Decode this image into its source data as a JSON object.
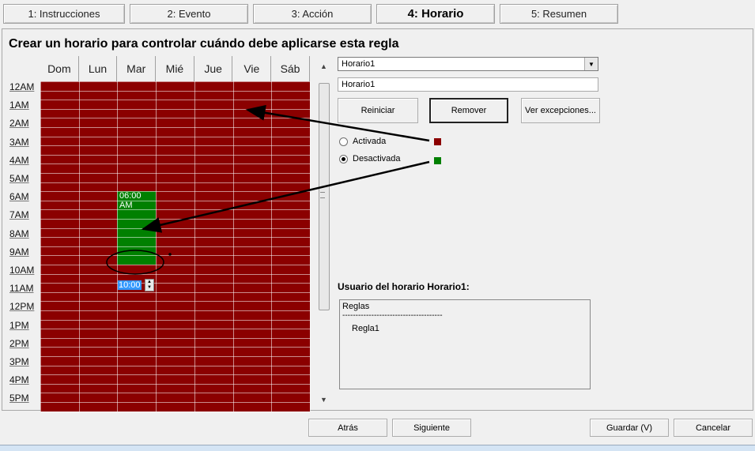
{
  "tabs": [
    {
      "label": "1: Instrucciones"
    },
    {
      "label": "2: Evento"
    },
    {
      "label": "3: Acción"
    },
    {
      "label": "4: Horario"
    },
    {
      "label": "5: Resumen"
    }
  ],
  "page_title": "Crear un horario para controlar cuándo debe aplicarse esta regla",
  "grid": {
    "days": [
      "Dom",
      "Lun",
      "Mar",
      "Mié",
      "Jue",
      "Vie",
      "Sáb"
    ],
    "hours": [
      "12AM",
      "1AM",
      "2AM",
      "3AM",
      "4AM",
      "5AM",
      "6AM",
      "7AM",
      "8AM",
      "9AM",
      "10AM",
      "11AM",
      "12PM",
      "1PM",
      "2PM",
      "3PM",
      "4PM",
      "5PM"
    ],
    "selection": {
      "day": "Mar",
      "start_label": "06:00 AM",
      "end_value": "10:00"
    }
  },
  "schedule": {
    "selected": "Horario1",
    "name_value": "Horario1"
  },
  "buttons": {
    "reset": "Reiniciar",
    "remove": "Remover",
    "exceptions": "Ver excepciones..."
  },
  "state_options": [
    {
      "label": "Activada",
      "checked": false,
      "color": "#8b0000"
    },
    {
      "label": "Desactivada",
      "checked": true,
      "color": "#008000"
    }
  ],
  "users": {
    "title": "Usuario del horario Horario1:",
    "header": "Reglas",
    "separator": "--------------------------------------",
    "items": [
      "Regla1"
    ]
  },
  "footer": {
    "back": "Atrás",
    "next": "Siguiente",
    "save": "Guardar (V)",
    "cancel": "Cancelar"
  },
  "colors": {
    "active": "#8b0000",
    "inactive": "#008000",
    "selection_text_bg": "#3399ff"
  }
}
